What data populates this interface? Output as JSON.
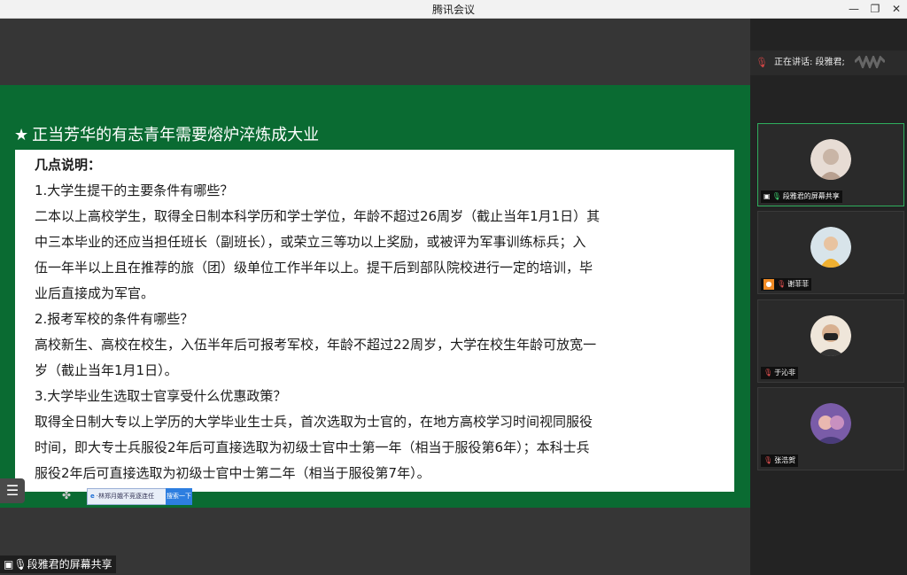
{
  "window": {
    "title": "腾讯会议"
  },
  "slide": {
    "title": "正当芳华的有志青年需要熔炉淬炼成大业",
    "lines": [
      "几点说明：",
      "1.大学生提干的主要条件有哪些？",
      "二本以上高校学生，取得全日制本科学历和学士学位，年龄不超过26周岁（截止当年1月1日）其",
      "中三本毕业的还应当担任班长（副班长），或荣立三等功以上奖励，或被评为军事训练标兵；入",
      "伍一年半以上且在推荐的旅（团）级单位工作半年以上。提干后到部队院校进行一定的培训，毕",
      "业后直接成为军官。",
      "2.报考军校的条件有哪些？",
      "高校新生、高校在校生，入伍半年后可报考军校，年龄不超过22周岁，大学在校生年龄可放宽一",
      "岁（截止当年1月1日）。",
      "3.大学毕业生选取士官享受什么优惠政策？",
      "取得全日制大专以上学历的大学毕业生士兵，首次选取为士官的，在地方高校学习时间视同服役",
      "时间，即大专士兵服役2年后可直接选取为初级士官中士第一年（相当于服役第6年）；本科士兵",
      "服役2年后可直接选取为初级士官中士第二年（相当于服役第7年）。"
    ]
  },
  "taskbar": {
    "search_text": "林郑月娥不竞逐连任",
    "search_button": "搜索一下"
  },
  "share_label": "段雅君的屏幕共享",
  "speaking": {
    "label": "正在讲话: 段雅君;"
  },
  "participants": [
    {
      "name": "段雅君的屏幕共享",
      "active": true
    },
    {
      "name": "谢菲菲",
      "active": false
    },
    {
      "name": "于沁非",
      "active": false
    },
    {
      "name": "张浩贺",
      "active": false
    }
  ],
  "colors": {
    "slide_bg": "#0a6b32",
    "active_border": "#2fae5d"
  }
}
